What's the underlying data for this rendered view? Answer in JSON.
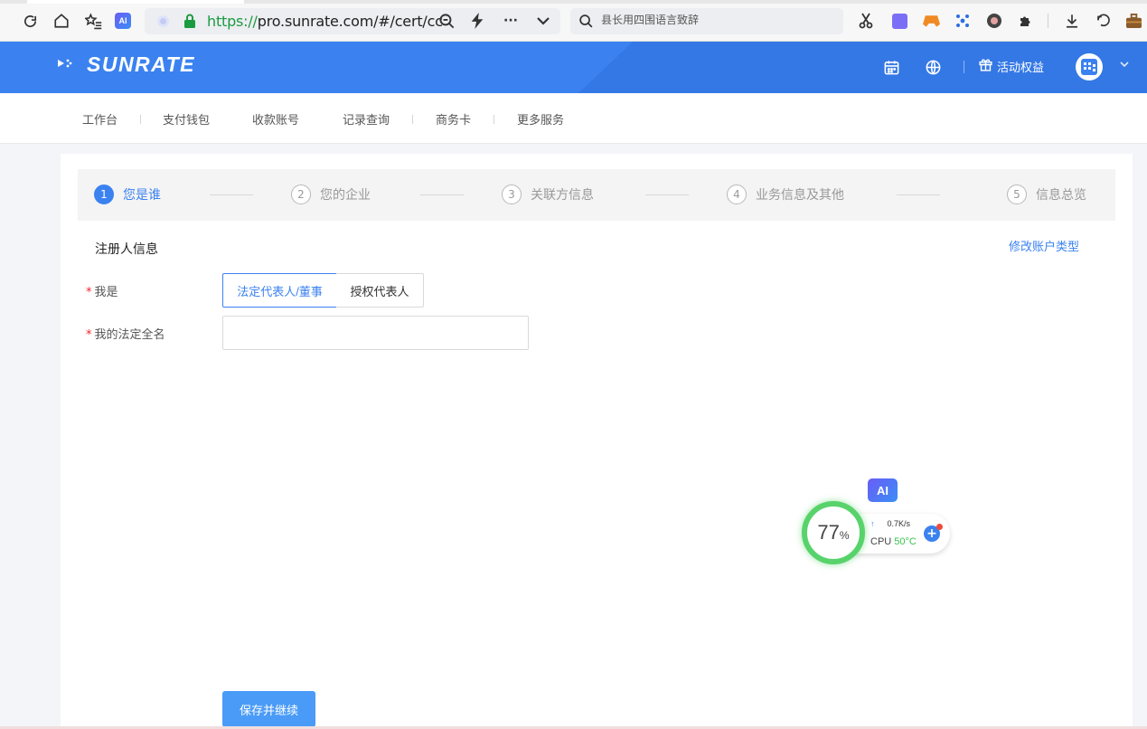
{
  "browser": {
    "url_protocol": "https://",
    "url_rest": "pro.sunrate.com/#/cert/cc",
    "search_text": "县长用四围语言致辞"
  },
  "header": {
    "logo_text": "SUNRATE",
    "benefits_label": "活动权益"
  },
  "nav": {
    "items": [
      "工作台",
      "支付钱包",
      "收款账号",
      "记录查询",
      "商务卡",
      "更多服务"
    ]
  },
  "steps": [
    {
      "num": "1",
      "label": "您是谁",
      "active": true
    },
    {
      "num": "2",
      "label": "您的企业",
      "active": false
    },
    {
      "num": "3",
      "label": "关联方信息",
      "active": false
    },
    {
      "num": "4",
      "label": "业务信息及其他",
      "active": false
    },
    {
      "num": "5",
      "label": "信息总览",
      "active": false
    }
  ],
  "form": {
    "section_title": "注册人信息",
    "change_type_link": "修改账户类型",
    "required_mark": "*",
    "role_label": "我是",
    "role_options": [
      "法定代表人/董事",
      "授权代表人"
    ],
    "role_selected": "法定代表人/董事",
    "name_label": "我的法定全名",
    "name_value": "",
    "save_button": "保存并继续"
  },
  "widget": {
    "ai_label": "AI",
    "percent": "77",
    "percent_unit": "%",
    "net_speed": "0.7K/s",
    "cpu_label": "CPU",
    "cpu_temp": "50°C"
  },
  "colors": {
    "brand": "#3b82f0",
    "required": "#f5222d",
    "monitor_green": "#58d36b"
  }
}
